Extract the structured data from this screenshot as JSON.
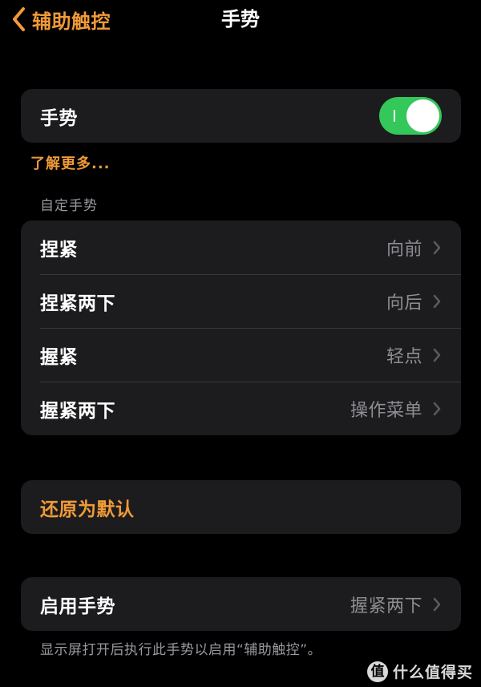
{
  "nav": {
    "back_label": "辅助触控",
    "title": "手势"
  },
  "gesture_toggle": {
    "label": "手势",
    "state": "on"
  },
  "learn_more": "了解更多...",
  "custom_section": {
    "header": "自定手势",
    "items": [
      {
        "label": "捏紧",
        "value": "向前"
      },
      {
        "label": "捏紧两下",
        "value": "向后"
      },
      {
        "label": "握紧",
        "value": "轻点"
      },
      {
        "label": "握紧两下",
        "value": "操作菜单"
      }
    ]
  },
  "reset": {
    "label": "还原为默认"
  },
  "enable_gesture": {
    "label": "启用手势",
    "value": "握紧两下"
  },
  "footer_note": "显示屏打开后执行此手势以启用“辅助触控”。",
  "watermark": {
    "badge": "值",
    "text": "什么值得买"
  },
  "colors": {
    "accent": "#f19a38",
    "toggle_on": "#34c759",
    "group_bg": "#1c1c1e",
    "background": "#000000",
    "secondary_text": "#8e8e93"
  },
  "icons": {
    "back": "chevron-left-icon",
    "disclosure": "chevron-right-icon"
  }
}
